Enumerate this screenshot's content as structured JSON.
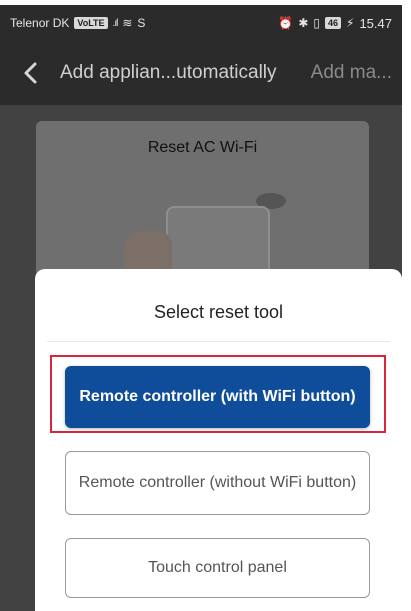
{
  "status_bar": {
    "carrier": "Telenor DK",
    "carrier_badge": "VoLTE",
    "signal": ".ıl",
    "wifi": "≋",
    "extra": "S",
    "alarm": "⏰",
    "bluetooth": "✱",
    "vibrate": "▯",
    "battery": "46",
    "charging": "⚡",
    "time": "15.47"
  },
  "nav": {
    "back_icon": "chevron-left-icon",
    "title": "Add applian...utomatically",
    "tab_manual": "Add ma..."
  },
  "card": {
    "title": "Reset AC Wi-Fi"
  },
  "sheet": {
    "title": "Select reset tool",
    "options": [
      {
        "label": "Remote controller (with WiFi button)",
        "selected": true
      },
      {
        "label": "Remote controller (without WiFi button)",
        "selected": false
      },
      {
        "label": "Touch control panel",
        "selected": false
      }
    ]
  },
  "colors": {
    "primary": "#0f4c9a",
    "highlight_border": "#d7263b",
    "overlay": "#424242",
    "sheet": "#ffffff"
  }
}
